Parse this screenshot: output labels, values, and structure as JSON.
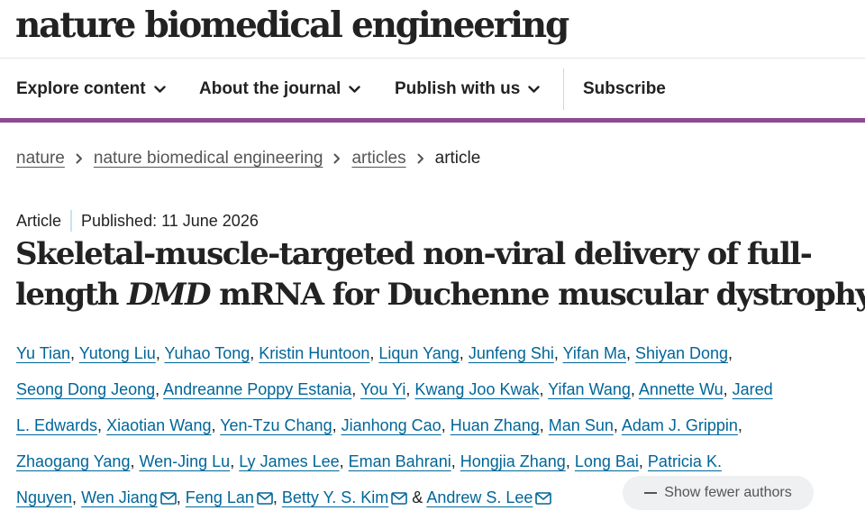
{
  "header": {
    "brand": "nature biomedical engineering"
  },
  "nav": {
    "explore": "Explore content",
    "about": "About the journal",
    "publish": "Publish with us",
    "subscribe": "Subscribe"
  },
  "breadcrumb": [
    {
      "label": "nature"
    },
    {
      "label": "nature biomedical engineering"
    },
    {
      "label": "articles"
    },
    {
      "label": "article"
    }
  ],
  "article": {
    "type": "Article",
    "published": "Published: 11 June 2026",
    "title_line1": "Skeletal-muscle-targeted non-viral delivery of full-",
    "title_line2_pre": "length ",
    "title_line2_italic": "DMD",
    "title_line2_post": " mRNA for Duchenne muscular dystrophy"
  },
  "authors": {
    "list": [
      "Yu Tian",
      "Yutong Liu",
      "Yuhao Tong",
      "Kristin Huntoon",
      "Liqun Yang",
      "Junfeng Shi",
      "Yifan Ma",
      "Shiyan Dong",
      "Seong Dong Jeong",
      "Andreanne Poppy Estania",
      "You Yi",
      "Kwang Joo Kwak",
      "Yifan Wang",
      "Annette Wu",
      "Jared",
      "L. Edwards",
      "Xiaotian Wang",
      "Yen-Tzu Chang",
      "Jianhong Cao",
      "Huan Zhang",
      "Man Sun",
      "Adam J. Grippin",
      "Zhaogang Yang",
      "Wen-Jing Lu",
      "Ly James Lee",
      "Eman Bahrani",
      "Hongjia Zhang",
      "Long Bai",
      "Patricia K.",
      "Nguyen",
      "Wen Jiang",
      "Feng Lan",
      "Betty Y. S. Kim",
      "Andrew S. Lee"
    ],
    "and_symbol": "&",
    "show_fewer": "Show fewer authors"
  },
  "icons": {
    "chevron": "chevron-down-icon",
    "crumb_separator": "chevron-right-icon",
    "mail": "mail-icon",
    "minus": "minus-icon"
  },
  "colors": {
    "link": "#006699",
    "accent_bar": "#8d4b91",
    "meta_divider": "#c9e3f2"
  }
}
